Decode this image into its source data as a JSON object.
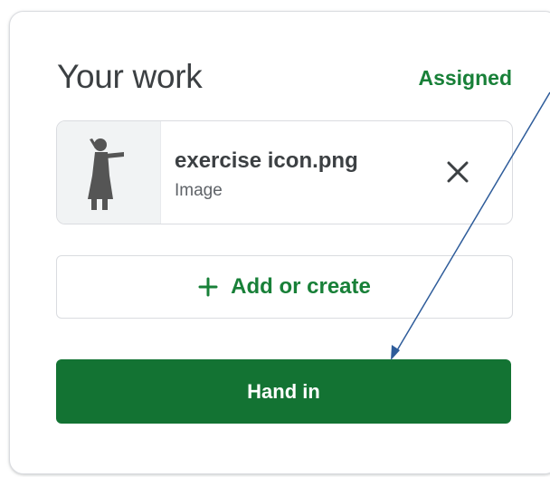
{
  "panel": {
    "title": "Your work",
    "status": "Assigned"
  },
  "attachment": {
    "name": "exercise icon.png",
    "type": "Image",
    "thumbnail_icon": "exercise-figure-icon",
    "remove_icon": "close-icon"
  },
  "actions": {
    "add_icon": "plus-icon",
    "add_label": "+ Add or create",
    "add_text": "Add or create",
    "hand_in_label": "Hand in"
  },
  "colors": {
    "accent_green": "#188038",
    "button_green": "#137333",
    "arrow": "#2e5c9a"
  }
}
